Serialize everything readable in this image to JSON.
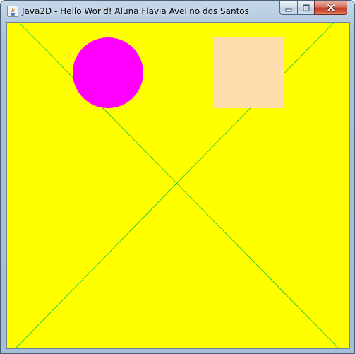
{
  "window": {
    "title": "Java2D - Hello World! Aluna Flavia Avelino dos Santos"
  },
  "controls": {
    "minimize_icon": "minimize-icon",
    "maximize_icon": "maximize-icon",
    "close_icon": "close-icon"
  },
  "canvas": {
    "background_color": "#ffff00",
    "line_color": "#00c040",
    "circle_color": "#ff00ff",
    "square_color": "#ffdead"
  }
}
